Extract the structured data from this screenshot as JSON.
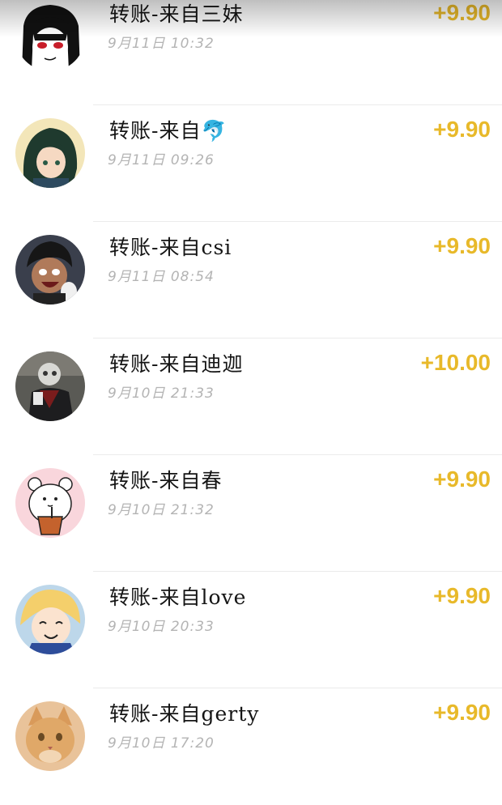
{
  "colors": {
    "amount": "#e8b92a",
    "title": "#151515",
    "time": "#b4b4b4",
    "divider": "#ebebeb"
  },
  "transactions": [
    {
      "title": "转账-来自三妹",
      "time": "9月11日 10:32",
      "amount": "+9.90",
      "avatar": "anime-girl-black-hair-avatar"
    },
    {
      "title": "转账-来自🐬",
      "time": "9月11日 09:26",
      "amount": "+9.90",
      "avatar": "anime-green-hair-avatar"
    },
    {
      "title": "转账-来自csi",
      "time": "9月11日 08:54",
      "amount": "+9.90",
      "avatar": "anime-boy-cheering-avatar"
    },
    {
      "title": "转账-来自迪迦",
      "time": "9月10日 21:33",
      "amount": "+10.00",
      "avatar": "figure-in-mask-avatar"
    },
    {
      "title": "转账-来自春",
      "time": "9月10日 21:32",
      "amount": "+9.90",
      "avatar": "white-bear-drink-avatar"
    },
    {
      "title": "转账-来自love",
      "time": "9月10日 20:33",
      "amount": "+9.90",
      "avatar": "sailor-moon-smiling-avatar"
    },
    {
      "title": "转账-来自gerty",
      "time": "9月10日 17:20",
      "amount": "+9.90",
      "avatar": "orange-cat-avatar"
    }
  ]
}
